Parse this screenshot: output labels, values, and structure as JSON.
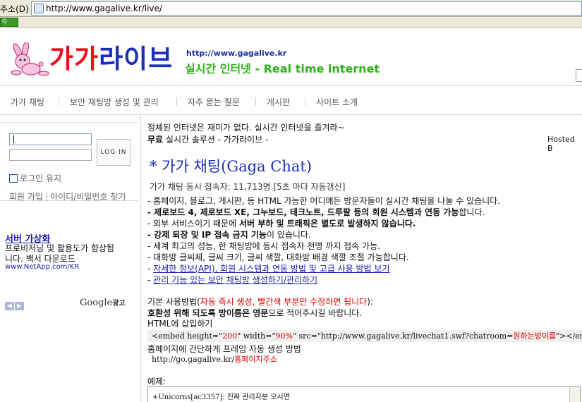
{
  "browser": {
    "address_label": "주소(D)",
    "url": "http://www.gagalive.kr/live/",
    "go_label": "G"
  },
  "header": {
    "logo_part1": "가가",
    "logo_part2": "라이브",
    "site_url": "http://www.gagalive.kr",
    "tagline": "실시간 인터넷 - Real time internet",
    "colors": {
      "logo_red": "#e8101c",
      "logo_blue": "#1c2fb6",
      "tagline_green": "#2fb21c"
    }
  },
  "nav": {
    "items": [
      "가가 채팅",
      "보안 채팅방 생성 및 관리",
      "자주 묻는 질문",
      "게시판",
      "사이트 소개"
    ]
  },
  "login": {
    "button": "LOG IN",
    "remember": "로그인 유지",
    "signup": "회원 가입",
    "find": "아이디/비밀번호 찾기"
  },
  "sidebar_ad": {
    "title": "서버 가상화",
    "line1": "프로비저닝 및 활용도가 향상됨",
    "line2": "니다. 백서 다운로드",
    "url": "www.NetApp.com/KR",
    "nav_prev": "◀",
    "nav_next": "▶",
    "google": "Google",
    "google_suffix": "광고"
  },
  "main": {
    "intro1": "정체된 인터넷은 재미가 없다. 실시간 인터넷을 즐겨라~",
    "intro2_bold": "무료",
    "intro2_rest": " 실시간 솔루션 - 가가라이브 -",
    "hosted": "Hosted B",
    "title": "* 가가 채팅(Gaga Chat)",
    "counter": "가가 채팅 동시 접속자: 11,713명 [5초 마다 자동갱신]",
    "bullets": {
      "b1": "- 홈페이지, 블로그, 게시판, 등 HTML 가능한 어디에든 방문자들이 실시간 채팅을 나눌 수 있습니다.",
      "b2_bold": "- 제로보드 4, 제로보드 XE, 그누보드, 테크노트, 드루팔 등의 회원 시스템과 연동 가능",
      "b2_rest": "합니다.",
      "b3_pre": "- 외부 서비스이기 때문에 ",
      "b3_bold": "서버 부하 및 트래픽은 별도로 발생하지 않습니다.",
      "b4_bold": "- 강제 퇴장 및 IP 접속 금지 기능",
      "b4_rest": "이 있습니다.",
      "b5": "- 세계 최고의 성능, 한 채팅방에 동시 접속자 천명 까지 접속 가능.",
      "b6": "- 대화방 글씨체, 글씨 크기, 글씨 색깔, 대화방 배경 색깔 조절 가능합니다.",
      "b7_dash": "- ",
      "b7_link": "자세한 정보(API), 회원 시스템과 연동 방법 및 고급 사용 방법 보기",
      "b8_dash": "- ",
      "b8_link": "관리 기능 있는 보안 채팅방 생성하기/관리하기"
    },
    "usage": {
      "label": "기본 사용방법(",
      "red": "자동 즉시 생성, 빨간색 부분만 수정하면 됩니다",
      "close": "):",
      "line2_bold": "호환성 위해 되도록 방이름은 영문",
      "line2_rest": "으로 적어주시길 바랍니다.",
      "line3": "HTML에 삽입하기"
    },
    "code": {
      "p1": "<embed height=\"",
      "height": "200",
      "p2": "\" width=\"",
      "width": "90%",
      "p3": "\" src=\"http://www.gagalive.kr/livechat1.swf?chatroom=",
      "room": "원하는방이름",
      "p4": "\"></embe"
    },
    "frame_line": "홈페이지에 간단하게 프레임 자동 생성 방법",
    "frame_url_base": "http://go.gagalive.kr/",
    "frame_url_red": "홈페이지주소",
    "example_label": "예제:",
    "chat_example": "+Unicorns[ac3357]: 진짜 관리자분 오시면"
  }
}
